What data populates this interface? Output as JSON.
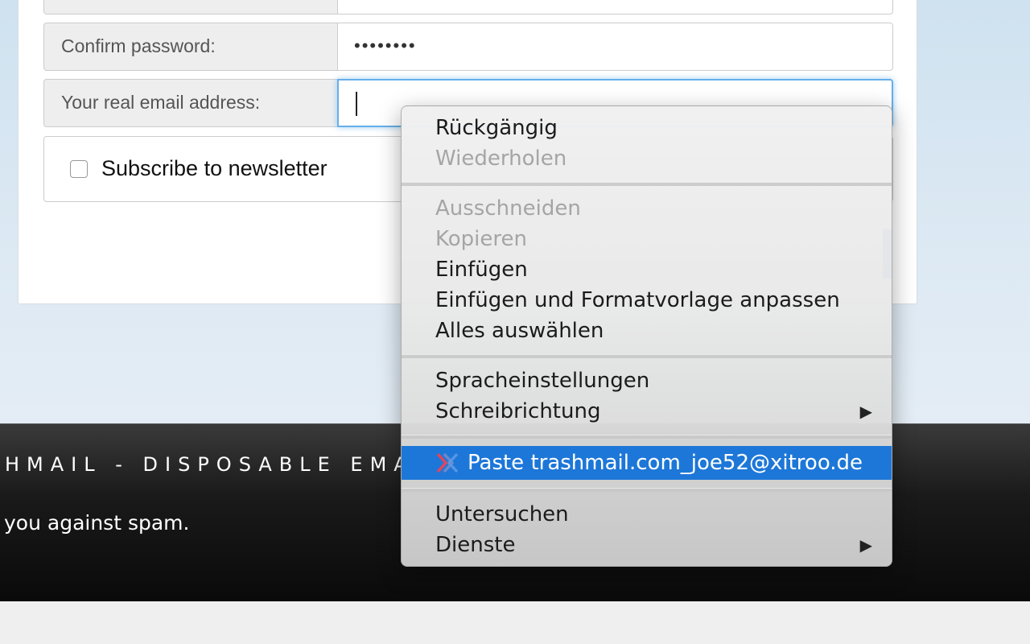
{
  "form": {
    "confirm_password_label": "Confirm password:",
    "confirm_password_value": "••••••••",
    "email_label": "Your real email address:",
    "email_value": "",
    "newsletter_label": "Subscribe to newsletter"
  },
  "footer": {
    "title": "HMAIL - DISPOSABLE EMAI",
    "text": "you against spam."
  },
  "context_menu": {
    "undo": "Rückgängig",
    "redo": "Wiederholen",
    "cut": "Ausschneiden",
    "copy": "Kopieren",
    "paste": "Einfügen",
    "paste_match_style": "Einfügen und Formatvorlage anpassen",
    "select_all": "Alles auswählen",
    "spelling": "Spracheinstellungen",
    "writing_direction": "Schreibrichtung",
    "paste_trashmail": "Paste trashmail.com_joe52@xitroo.de",
    "inspect": "Untersuchen",
    "services": "Dienste",
    "submenu_arrow": "▶",
    "highlight_color": "#1d77d8"
  },
  "icons": {
    "extension": "trashmail-extension-icon"
  }
}
